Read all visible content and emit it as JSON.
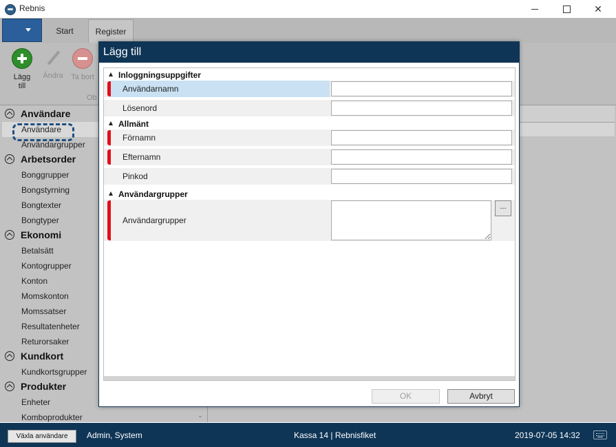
{
  "window": {
    "title": "Rebnis"
  },
  "ribbon": {
    "tabs": [
      {
        "label": "Start"
      },
      {
        "label": "Register"
      }
    ],
    "buttons": {
      "add": "Lägg till",
      "edit": "Ändra",
      "delete": "Ta bort"
    },
    "group_label": "Ob"
  },
  "sidebar": {
    "groups": [
      {
        "label": "Användare",
        "items": [
          "Användare",
          "Användargrupper"
        ]
      },
      {
        "label": "Arbetsorder",
        "items": [
          "Bonggrupper",
          "Bongstyrning",
          "Bongtexter",
          "Bongtyper"
        ]
      },
      {
        "label": "Ekonomi",
        "items": [
          "Betalsätt",
          "Kontogrupper",
          "Konton",
          "Momskonton",
          "Momssatser",
          "Resultatenheter",
          "Returorsaker"
        ]
      },
      {
        "label": "Kundkort",
        "items": [
          "Kundkortsgrupper"
        ]
      },
      {
        "label": "Produkter",
        "items": [
          "Enheter",
          "Komboprodukter"
        ]
      }
    ],
    "selected_item": "Användare"
  },
  "dialog": {
    "title": "Lägg till",
    "categories": {
      "login": "Inloggningsuppgifter",
      "general": "Allmänt",
      "groups": "Användargrupper"
    },
    "fields": {
      "username": {
        "label": "Användarnamn",
        "value": "",
        "required": true
      },
      "password": {
        "label": "Lösenord",
        "value": "",
        "required": false
      },
      "firstname": {
        "label": "Förnamn",
        "value": "",
        "required": true
      },
      "lastname": {
        "label": "Efternamn",
        "value": "",
        "required": true
      },
      "pincode": {
        "label": "Pinkod",
        "value": "",
        "required": false
      },
      "usergroups": {
        "label": "Användargrupper",
        "value": "",
        "required": true,
        "browse_label": "..."
      }
    },
    "ok_label": "OK",
    "cancel_label": "Avbryt"
  },
  "statusbar": {
    "switch_user_label": "Växla användare",
    "user": "Admin, System",
    "register": "Kassa 14 | Rebnisfiket",
    "datetime": "2019-07-05 14:32"
  },
  "colors": {
    "dialog_header": "#0f3556",
    "required_marker": "#e0101a",
    "selection": "#c9e1f3",
    "add_icon": "#2e8f2a"
  }
}
